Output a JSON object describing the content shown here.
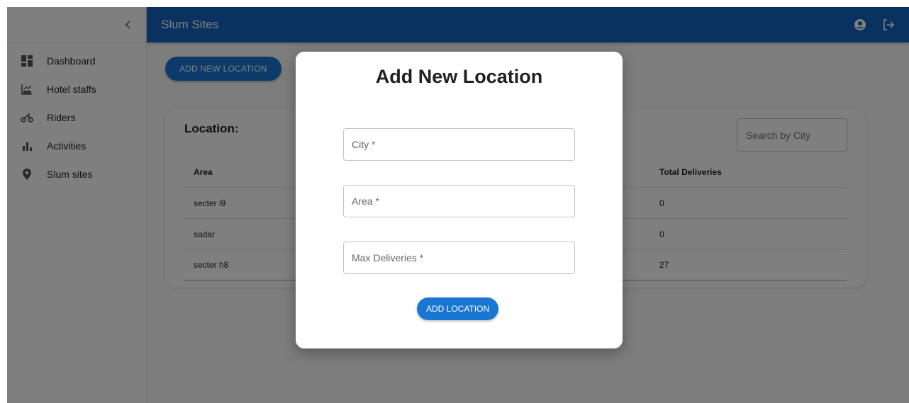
{
  "appbar": {
    "title": "Slum Sites"
  },
  "sidebar": {
    "items": [
      {
        "label": "Dashboard",
        "icon": "dashboard-icon"
      },
      {
        "label": "Hotel staffs",
        "icon": "hotel-staff-icon"
      },
      {
        "label": "Riders",
        "icon": "motorcycle-icon"
      },
      {
        "label": "Activities",
        "icon": "bar-chart-icon"
      },
      {
        "label": "Slum sites",
        "icon": "location-pin-icon"
      }
    ]
  },
  "main": {
    "add_button_label": "ADD NEW LOCATION",
    "card_title": "Location:",
    "search_placeholder": "Search by City",
    "table": {
      "headers": {
        "area": "Area",
        "total": "Total Deliveries"
      },
      "rows": [
        {
          "area": "secter i9",
          "total": "0"
        },
        {
          "area": "sadar",
          "total": "0"
        },
        {
          "area": "secter h8",
          "total": "27"
        }
      ]
    }
  },
  "modal": {
    "title": "Add New Location",
    "city_placeholder": "City *",
    "area_placeholder": "Area *",
    "max_placeholder": "Max Deliveries *",
    "submit_label": "ADD LOCATION"
  },
  "colors": {
    "primary": "#1565c0",
    "button": "#1976d2"
  }
}
